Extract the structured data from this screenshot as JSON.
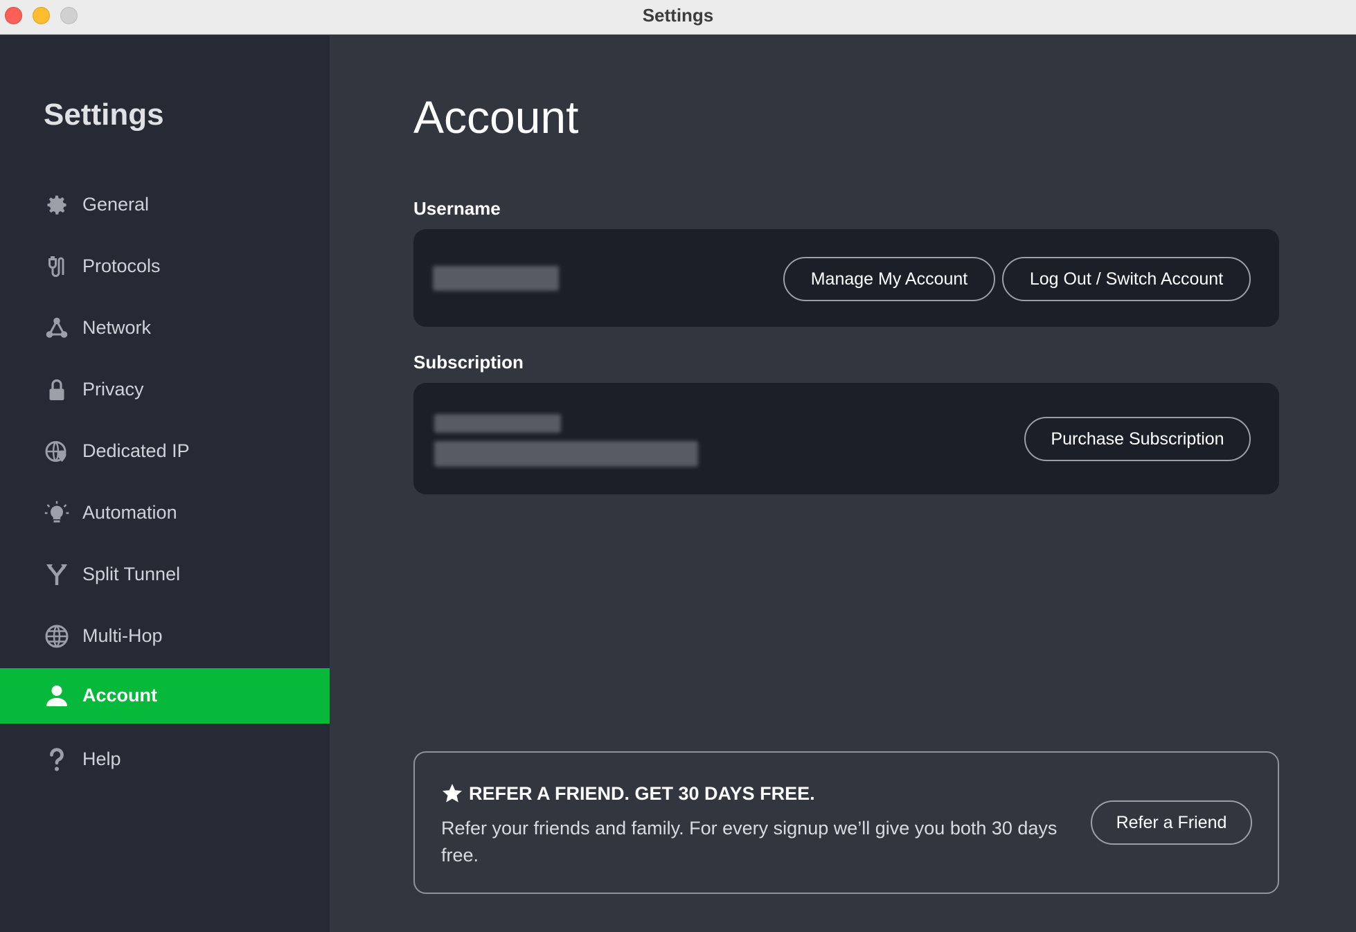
{
  "window": {
    "title": "Settings"
  },
  "sidebar": {
    "heading": "Settings",
    "items": [
      {
        "label": "General",
        "icon": "gear-icon",
        "active": false
      },
      {
        "label": "Protocols",
        "icon": "plug-icon",
        "active": false
      },
      {
        "label": "Network",
        "icon": "network-icon",
        "active": false
      },
      {
        "label": "Privacy",
        "icon": "lock-icon",
        "active": false
      },
      {
        "label": "Dedicated IP",
        "icon": "globe-pin-icon",
        "active": false
      },
      {
        "label": "Automation",
        "icon": "lightbulb-icon",
        "active": false
      },
      {
        "label": "Split Tunnel",
        "icon": "split-icon",
        "active": false
      },
      {
        "label": "Multi-Hop",
        "icon": "globe-icon",
        "active": false
      },
      {
        "label": "Account",
        "icon": "user-icon",
        "active": true
      },
      {
        "label": "Help",
        "icon": "question-icon",
        "active": false
      }
    ]
  },
  "main": {
    "title": "Account",
    "username": {
      "label": "Username",
      "manage_button": "Manage My Account",
      "logout_button": "Log Out / Switch Account"
    },
    "subscription": {
      "label": "Subscription",
      "purchase_button": "Purchase Subscription"
    },
    "refer": {
      "headline": "REFER A FRIEND. GET 30 DAYS FREE.",
      "description": "Refer your friends and family. For every signup we’ll give you both 30 days free.",
      "button": "Refer a Friend",
      "icon": "star-icon"
    }
  },
  "colors": {
    "active_green": "#06b93a",
    "sidebar_bg": "#252a35",
    "main_bg": "#31363f",
    "card_bg": "#1b1f27"
  }
}
